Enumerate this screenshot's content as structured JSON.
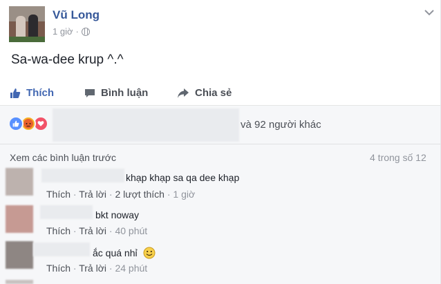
{
  "post": {
    "author": "Vũ Long",
    "time": "1 giờ",
    "text": "Sa-wa-dee krup ^.^"
  },
  "actions": {
    "like": "Thích",
    "comment": "Bình luận",
    "share": "Chia sẻ"
  },
  "reactions": {
    "others_text": "và 92 người khác",
    "icons": [
      "like-icon",
      "angry-icon",
      "love-icon"
    ]
  },
  "comments_header": {
    "view_previous": "Xem các bình luận trước",
    "count": "4 trong số 12"
  },
  "comments": [
    {
      "text": "khạp khạp sa qa dee khạp",
      "like": "Thích",
      "reply": "Trả lời",
      "likes": "2 lượt thích",
      "time": "1 giờ"
    },
    {
      "text": "bkt noway",
      "like": "Thích",
      "reply": "Trả lời",
      "time": "40 phút"
    },
    {
      "text": "ắc quá nhỉ",
      "like": "Thích",
      "reply": "Trả lời",
      "time": "24 phút"
    }
  ],
  "colors": {
    "link": "#365899",
    "like_blue": "#4267b2",
    "muted": "#90949c"
  }
}
